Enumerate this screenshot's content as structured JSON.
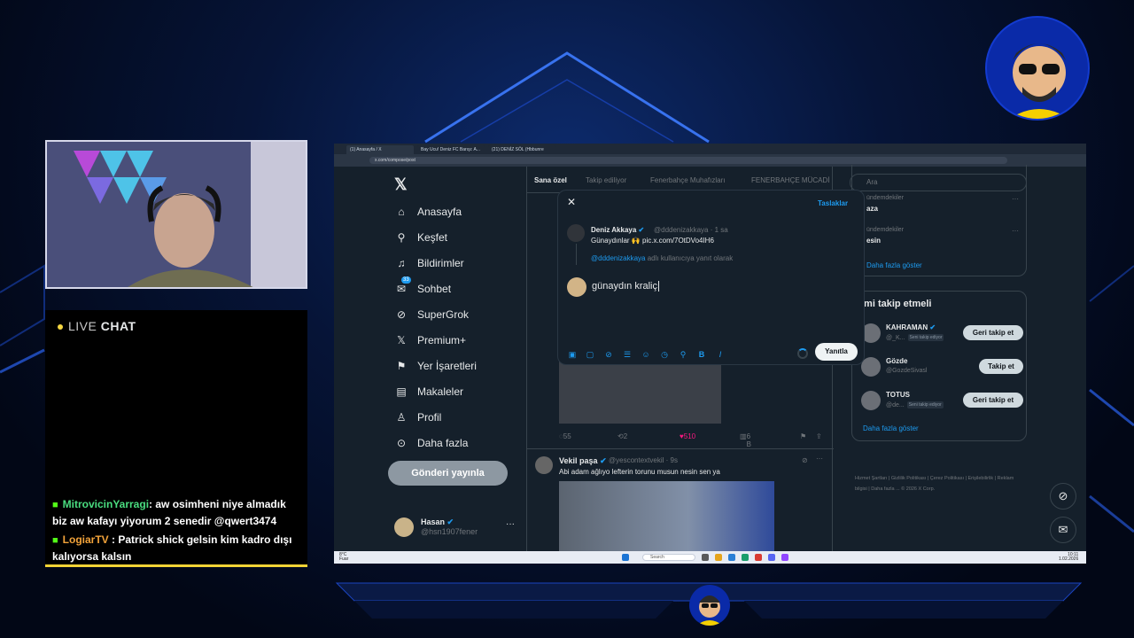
{
  "overlay": {
    "chat_live": "LIVE",
    "chat_chat": "CHAT",
    "messages": [
      {
        "user": "MitrovicinYarragi",
        "user_color": "#4ade80",
        "text": ": aw osimheni niye almadık biz aw kafayı yiyorum 2 senedir @qwert3474"
      },
      {
        "user": "LogiarTV",
        "user_color": "#f2a33a",
        "text": ": Patrick shick gelsin kim kadro dışı kalıyorsa kalsın"
      }
    ]
  },
  "browser": {
    "tabs": [
      "(1) Anasayfa / X",
      "Bay Ucu! Deniz FC Barışı: A...",
      "(21) DENİZ SÖL (Hbbunre"
    ],
    "url": "x.com/compose/post"
  },
  "sidebar": {
    "items": [
      {
        "label": "Anasayfa",
        "icon": "home-icon"
      },
      {
        "label": "Keşfet",
        "icon": "search-icon"
      },
      {
        "label": "Bildirimler",
        "icon": "bell-icon"
      },
      {
        "label": "Sohbet",
        "icon": "chat-icon",
        "badge": "33"
      },
      {
        "label": "SuperGrok",
        "icon": "grok-icon"
      },
      {
        "label": "Premium+",
        "icon": "x-icon"
      },
      {
        "label": "Yer İşaretleri",
        "icon": "bookmark-icon"
      },
      {
        "label": "Makaleler",
        "icon": "article-icon"
      },
      {
        "label": "Profil",
        "icon": "person-icon"
      },
      {
        "label": "Daha fazla",
        "icon": "more-circle-icon"
      }
    ],
    "post_button": "Gönderi yayınla",
    "profile_name": "Hasan",
    "profile_handle": "@hsn1907fener"
  },
  "feed": {
    "tabs": [
      "Sana özel",
      "Takip ediliyor",
      "Fenerbahçe Muhafızları",
      "FENERBAHÇE MÜCADİ"
    ],
    "post1_actions": {
      "replies": "55",
      "reposts": "2",
      "likes": "510",
      "views": "6 B"
    },
    "post2": {
      "name": "Vekil paşa",
      "handle": "@yescontextvekil",
      "time": "· 9s",
      "text": "Abi adam ağlıyo lefterin torunu musun nesin sen ya"
    }
  },
  "right": {
    "search_placeholder": "Ara",
    "trends": [
      {
        "category": "ündemdekiler",
        "name": "aza"
      },
      {
        "category": "ündemdekiler",
        "name": "esin"
      }
    ],
    "show_more": "Daha fazla göster",
    "who_to_follow": "imi takip etmeli",
    "users": [
      {
        "name": "KAHRAMAN",
        "handle": "@_K...",
        "tag": "Seni takip ediyor",
        "button": "Geri takip et"
      },
      {
        "name": "Gözde",
        "handle": "@GozdeSivasl",
        "tag": "",
        "button": "Takip et"
      },
      {
        "name": "TOTUS",
        "handle": "@de...",
        "tag": "Seni takip ediyor",
        "button": "Geri takip et"
      }
    ],
    "show_more2": "Daha fazla göster",
    "footer": "Hizmet Şartları | Gizlilik Politikası | Çerez Politikası | Erişilebilirlik | Reklam bilgisi | Daha fazla ... © 2026 X Corp."
  },
  "modal": {
    "drafts": "Taslaklar",
    "orig_name": "Deniz Akkaya",
    "orig_handle": "@dddenizakkaya · 1 sa",
    "orig_text": "Günaydınlar 🙌 pic.x.com/7OtDVo4IH6",
    "reply_mention": "@dddenizakkaya",
    "reply_suffix": " adlı kullanıcıya yanıt olarak",
    "compose_text": "günaydın kraliç",
    "reply_button": "Yanıtla"
  },
  "taskbar": {
    "search": "Search",
    "weather_temp": "8°C",
    "weather_desc": "Fuar",
    "time": "10:11",
    "date": "1.02.2026"
  },
  "colors": {
    "accent": "#1d9bf0",
    "bg": "#15202b",
    "like": "#f91880",
    "kick": "#53fc18",
    "chat_border": "#f2d335"
  }
}
